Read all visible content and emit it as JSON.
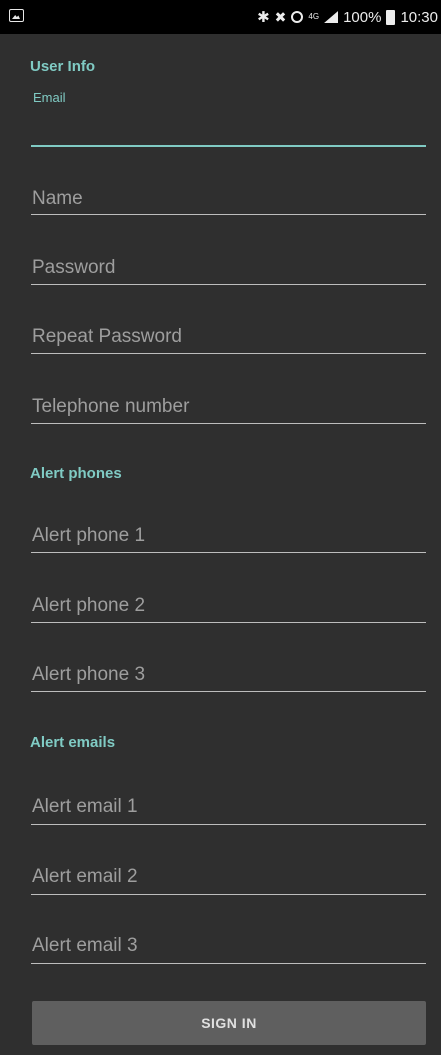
{
  "status_bar": {
    "battery": "100%",
    "time": "10:30",
    "network": "4G",
    "icons": [
      "image-icon",
      "bluetooth-icon",
      "mute-icon",
      "alarm-icon",
      "4g-icon",
      "signal-icon",
      "battery-icon"
    ]
  },
  "user_info": {
    "header": "User Info",
    "email_label": "Email",
    "email_value": "",
    "name_placeholder": "Name",
    "password_placeholder": "Password",
    "repeat_password_placeholder": "Repeat Password",
    "telephone_placeholder": "Telephone number"
  },
  "alert_phones": {
    "header": "Alert phones",
    "phone1_placeholder": "Alert phone 1",
    "phone2_placeholder": "Alert phone 2",
    "phone3_placeholder": "Alert phone 3"
  },
  "alert_emails": {
    "header": "Alert emails",
    "email1_placeholder": "Alert email 1",
    "email2_placeholder": "Alert email 2",
    "email3_placeholder": "Alert email 3"
  },
  "actions": {
    "sign_in_label": "SIGN IN"
  },
  "colors": {
    "accent": "#80cbc4",
    "background": "#2f2f2f",
    "hint": "#9e9e9e",
    "button": "#5f5f5f"
  }
}
